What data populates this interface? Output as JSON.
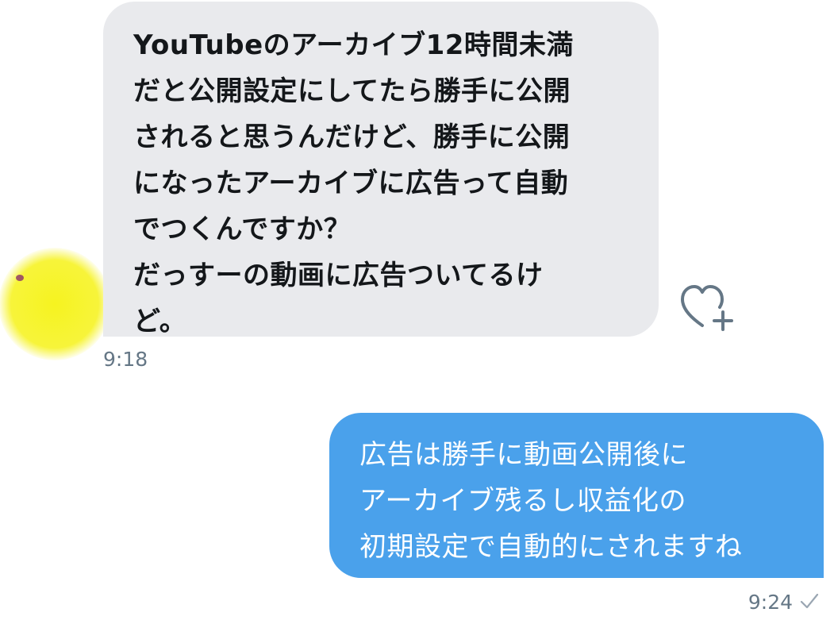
{
  "messages": {
    "received": {
      "lines": [
        "YouTubeのアーカイブ12時間未満",
        "だと公開設定にしてたら勝手に公開",
        "されると思うんだけど、勝手に公開",
        "になったアーカイブに広告って自動",
        "でつくんですか？",
        "だっすーの動画に広告ついてるけ",
        "ど。"
      ],
      "time": "9:18"
    },
    "sent": {
      "lines": [
        "広告は勝手に動画公開後に",
        "アーカイブ残るし収益化の",
        "初期設定で自動的にされますね"
      ],
      "time": "9:24",
      "status_icon": "check-icon"
    }
  },
  "icons": {
    "like": "heart-plus-icon",
    "avatar": "avatar"
  },
  "colors": {
    "received_bubble": "#e9eaed",
    "sent_bubble": "#4aa1eb",
    "timestamp": "#657786",
    "avatar": "#f6f320"
  }
}
